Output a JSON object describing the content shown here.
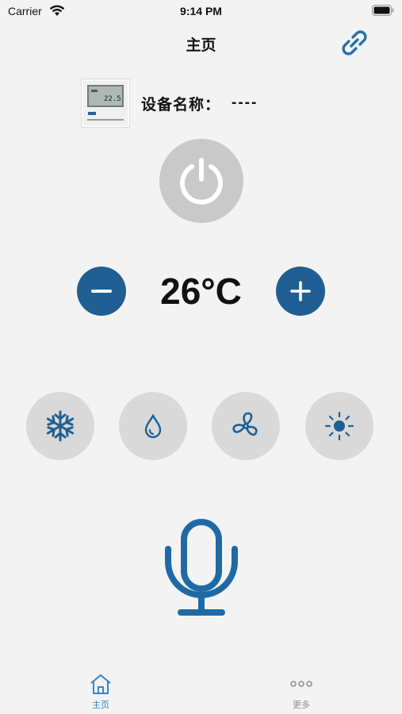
{
  "status_bar": {
    "carrier": "Carrier",
    "time": "9:14 PM"
  },
  "nav": {
    "title": "主页",
    "link_icon": "link-icon"
  },
  "device": {
    "thumbnail_icon": "thermostat-image",
    "name_label": "设备名称：",
    "name_value": "----"
  },
  "power": {
    "icon": "power-icon"
  },
  "temperature": {
    "value": "26°C",
    "decrease_icon": "minus-icon",
    "increase_icon": "plus-icon"
  },
  "modes": [
    {
      "name": "cool",
      "icon": "snowflake-icon"
    },
    {
      "name": "dry",
      "icon": "water-drop-icon"
    },
    {
      "name": "fan",
      "icon": "fan-icon"
    },
    {
      "name": "heat",
      "icon": "sun-icon"
    }
  ],
  "voice": {
    "icon": "microphone-icon"
  },
  "tabs": [
    {
      "label": "主页",
      "icon": "home-icon",
      "active": true
    },
    {
      "label": "更多",
      "icon": "more-icon",
      "active": false
    }
  ],
  "colors": {
    "accent": "#1f5f93",
    "tab_active": "#2f86d4",
    "tab_inactive": "#8e8e93",
    "mode_bg": "#d9d9d9",
    "power_bg": "#c9c9c9",
    "background": "#f3f3f3"
  }
}
